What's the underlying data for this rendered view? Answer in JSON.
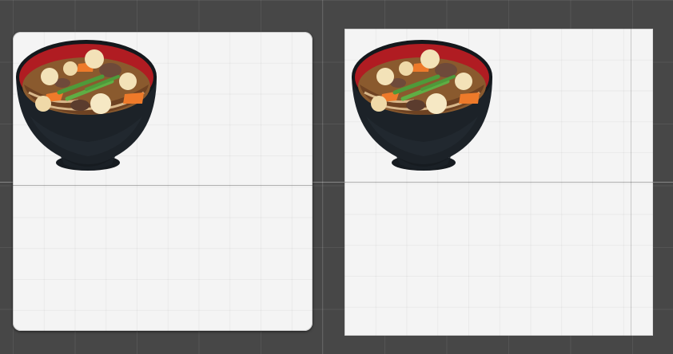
{
  "scene": {
    "background_color": "#474747"
  },
  "images": [
    {
      "icon": "soup-bowl-icon",
      "frame_style": "rounded-sliced",
      "background": "#f4f4f4"
    },
    {
      "icon": "soup-bowl-icon",
      "frame_style": "simple",
      "background": "#f4f4f4"
    }
  ],
  "colors": {
    "bowl_body": "#1c2228",
    "bowl_rim_inner": "#b01c22",
    "broth": "#8a5a2e",
    "carrot": "#ee7a2a",
    "green_onion": "#4e9a3a",
    "dumpling": "#f3e2b8",
    "mushroom": "#6e4a3a"
  }
}
